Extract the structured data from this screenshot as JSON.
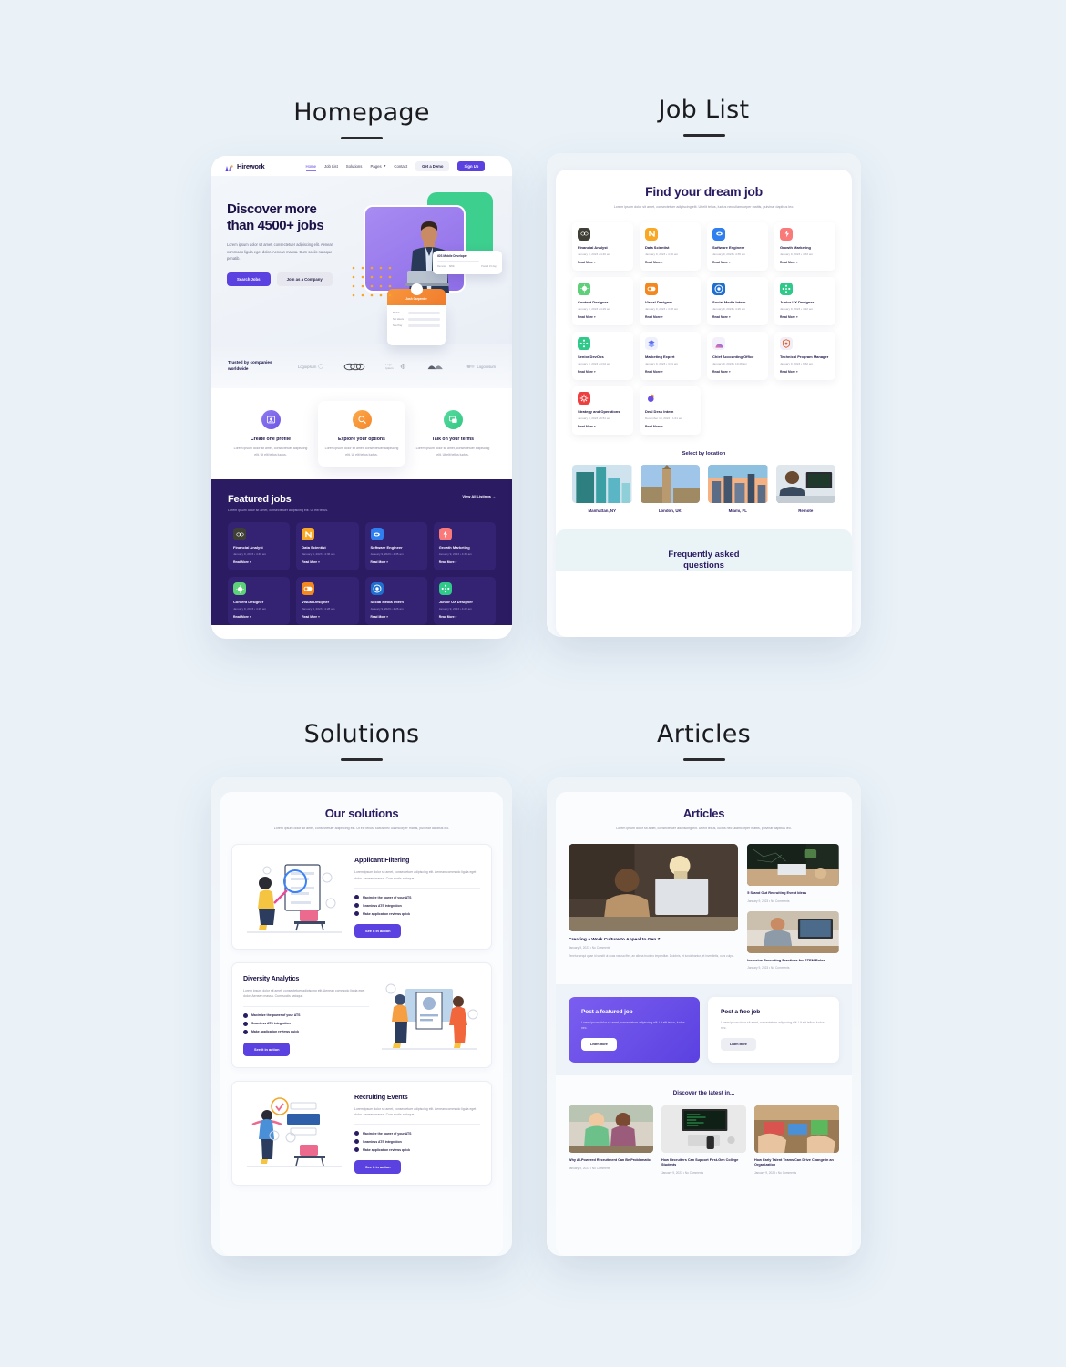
{
  "panels": {
    "homepage": "Homepage",
    "joblist": "Job List",
    "solutions": "Solutions",
    "articles": "Articles"
  },
  "homepage": {
    "brand": "Hirework",
    "nav": [
      {
        "label": "Home",
        "active": true
      },
      {
        "label": "Job List",
        "active": false
      },
      {
        "label": "Solutions",
        "active": false
      },
      {
        "label": "Pages",
        "active": false,
        "caret": true
      },
      {
        "label": "Contact",
        "active": false
      }
    ],
    "demo_button": "Get a Demo",
    "signup_button": "Sign Up",
    "hero": {
      "heading_line1": "Discover more",
      "heading_line2": "than 4500+ jobs",
      "subtext": "Lorem ipsum dolor sit amet, consectetuer adipiscing elit. Aenean commodo ligula eget dolor. Aenean massa. Cum sociis natoque penatib.",
      "primary_button": "Search Jobs",
      "secondary_button": "Join as a Company",
      "card_title": "iOS Mobile Developer",
      "card_label_left": "Remote",
      "card_label_right": "$80k",
      "card_label_time": "Posted 15 days",
      "profile_name": "Josh Carpenter",
      "profile_field1": "Mobile",
      "profile_field2": "Set Hours",
      "profile_field3": "See Pay"
    },
    "trusted": {
      "label_line1": "Trusted by companies",
      "label_line2": "worldwide",
      "logos": [
        "Logoipsum",
        "Logoipsum",
        "Logo Ipsum",
        "Logoipsum",
        "Logoipsum"
      ]
    },
    "features": [
      {
        "title": "Create one profile",
        "text": "Lorem ipsum dolor sit amet, consectetuer adipiscing elit. Ut elit tellus luctus.",
        "icon": "user-card-icon",
        "color": "purple"
      },
      {
        "title": "Explore your options",
        "text": "Lorem ipsum dolor sit amet, consectetuer adipiscing elit. Ut elit tellus luctus.",
        "icon": "search-icon",
        "color": "orange"
      },
      {
        "title": "Talk on your terms",
        "text": "Lorem ipsum dolor sit amet, consectetuer adipiscing elit. Ut elit tellus luctus.",
        "icon": "chat-icon",
        "color": "green"
      }
    ],
    "featured": {
      "title": "Featured jobs",
      "subtitle": "Lorem ipsum dolor sit amet, consectetuer adipiscing elit. Ut elit tellus.",
      "view_all": "View All Listings →"
    },
    "featured_jobs": [
      {
        "name": "Financial Analyst",
        "date": "January 9, 2023 • 4:40 am",
        "more": "Read More »",
        "icon_bg": "#3f3f36",
        "icon": "infinity-icon"
      },
      {
        "name": "Data Scientist",
        "date": "January 9, 2023 • 4:36 am",
        "more": "Read More »",
        "icon_bg": "#f9a826",
        "icon": "n-mark-icon"
      },
      {
        "name": "Software Engineer",
        "date": "January 9, 2023 • 4:35 am",
        "more": "Read More »",
        "icon_bg": "#2f7ff0",
        "icon": "cloud-icon"
      },
      {
        "name": "Growth Marketing",
        "date": "January 9, 2023 • 4:33 am",
        "more": "Read More »",
        "icon_bg": "#fa7a7a",
        "icon": "bolt-icon"
      },
      {
        "name": "Content Designer",
        "date": "January 9, 2023 • 4:29 am",
        "more": "Read More »",
        "icon_bg": "#5ed07a",
        "icon": "sun-icon"
      },
      {
        "name": "Visual Designer",
        "date": "January 9, 2023 • 4:28 am",
        "more": "Read More »",
        "icon_bg": "#f5871f",
        "icon": "toggle-icon"
      },
      {
        "name": "Social Media Intern",
        "date": "January 9, 2023 • 4:26 am",
        "more": "Read More »",
        "icon_bg": "#1f6fd0",
        "icon": "target-icon"
      },
      {
        "name": "Junior UX Designer",
        "date": "January 9, 2023 • 4:22 am",
        "more": "Read More »",
        "icon_bg": "#2fc98a",
        "icon": "nodes-icon"
      }
    ]
  },
  "joblist": {
    "heading": "Find your dream job",
    "subtext": "Lorem ipsum dolor sit amet, consectetuer adipiscing elit. Ut elit tellus, luctus nec ullamcorper mattis, pulvinar dapibus leo.",
    "jobs": [
      {
        "name": "Financial Analyst",
        "date": "January 9, 2023 • 4:40 am",
        "more": "Read More »",
        "icon_bg": "#3f3f36",
        "icon": "infinity-icon"
      },
      {
        "name": "Data Scientist",
        "date": "January 9, 2023 • 4:36 am",
        "more": "Read More »",
        "icon_bg": "#f9a826",
        "icon": "n-mark-icon"
      },
      {
        "name": "Software Engineer",
        "date": "January 9, 2023 • 4:35 am",
        "more": "Read More »",
        "icon_bg": "#2f7ff0",
        "icon": "cloud-icon"
      },
      {
        "name": "Growth Marketing",
        "date": "January 9, 2023 • 4:33 am",
        "more": "Read More »",
        "icon_bg": "#fa7a7a",
        "icon": "bolt-icon"
      },
      {
        "name": "Content Designer",
        "date": "January 9, 2023 • 4:29 am",
        "more": "Read More »",
        "icon_bg": "#5ed07a",
        "icon": "sun-icon"
      },
      {
        "name": "Visual Designer",
        "date": "January 9, 2023 • 4:28 am",
        "more": "Read More »",
        "icon_bg": "#f5871f",
        "icon": "toggle-icon"
      },
      {
        "name": "Social Media Intern",
        "date": "January 9, 2023 • 4:26 am",
        "more": "Read More »",
        "icon_bg": "#1f6fd0",
        "icon": "target-icon"
      },
      {
        "name": "Junior UX Designer",
        "date": "January 9, 2023 • 4:22 am",
        "more": "Read More »",
        "icon_bg": "#2fc98a",
        "icon": "nodes-icon"
      },
      {
        "name": "Senior DevOps",
        "date": "January 9, 2023 • 4:04 am",
        "more": "Read More »",
        "icon_bg": "#2fc98a",
        "icon": "nodes-icon"
      },
      {
        "name": "Marketing Expert",
        "date": "January 9, 2023 • 4:01 am",
        "more": "Read More »",
        "icon_bg": "#eef1fb",
        "icon": "layers-icon"
      },
      {
        "name": "Chief Accounting Office",
        "date": "January 9, 2023 • 10:48 am",
        "more": "Read More »",
        "icon_bg": "#f4f0fb",
        "icon": "arch-icon"
      },
      {
        "name": "Technical Program Manager",
        "date": "January 9, 2023 • 9:52 am",
        "more": "Read More »",
        "icon_bg": "#f2eef8",
        "icon": "shield-icon"
      },
      {
        "name": "Strategy and Operations",
        "date": "January 9, 2023 • 9:51 am",
        "more": "Read More »",
        "icon_bg": "#ef3e3e",
        "icon": "gear-icon"
      },
      {
        "name": "Deal Desk Intern",
        "date": "December 19, 2022 • 1:21 am",
        "more": "Read More »",
        "icon_bg": "#ffffff",
        "icon": "pie-icon"
      }
    ],
    "location_heading": "Select by location",
    "locations": [
      {
        "name": "Manhattan, NY",
        "image": "skyscrapers-photo"
      },
      {
        "name": "London, UK",
        "image": "big-ben-photo"
      },
      {
        "name": "Miami, FL",
        "image": "miami-skyline-photo"
      },
      {
        "name": "Remote",
        "image": "remote-worker-photo"
      }
    ],
    "faq_line1": "Frequently asked",
    "faq_line2": "questions"
  },
  "solutions": {
    "heading": "Our solutions",
    "subtext": "Lorem ipsum dolor sit amet, consectetuer adipiscing elit. Ut elit tellus, luctus nec ullamcorper mattis, pulvinar dapibus leo.",
    "items": [
      {
        "title": "Applicant Filtering",
        "text": "Lorem ipsum dolor sit amet, consectetuer adipiscing elit. Aenean commodo ligula eget dolor. Aenean massa. Cum sociis natoque.",
        "bullets": [
          "Maximize the power of your ATS",
          "Seamless ATS integration",
          "Make application reviews quick"
        ],
        "button": "See it in action",
        "image_side": "left",
        "illustration": "woman-with-magnifier-illustration"
      },
      {
        "title": "Diversity Analytics",
        "text": "Lorem ipsum dolor sit amet, consectetuer adipiscing elit. Aenean commodo ligula eget dolor. Aenean massa. Cum sociis natoque.",
        "bullets": [
          "Maximize the power of your ATS",
          "Seamless ATS integration",
          "Make application reviews quick"
        ],
        "button": "See it in action",
        "image_side": "right",
        "illustration": "two-people-dashboard-illustration"
      },
      {
        "title": "Recruiting Events",
        "text": "Lorem ipsum dolor sit amet, consectetuer adipiscing elit. Aenean commodo ligula eget dolor. Aenean massa. Cum sociis natoque.",
        "bullets": [
          "Maximize the power of your ATS",
          "Seamless ATS integration",
          "Make application reviews quick"
        ],
        "button": "See it in action",
        "image_side": "left",
        "illustration": "celebrating-woman-illustration"
      }
    ]
  },
  "articles": {
    "heading": "Articles",
    "subtext": "Lorem ipsum dolor sit amet, consectetuer adipiscing elit. Ut elit tellus, luctus nec ullamcorper mattis, pulvinar dapibus leo.",
    "feature": {
      "title": "Creating a Work Culture to Appeal to Gen Z",
      "meta": "January 9, 2023 • No Comments",
      "excerpt": "Tenetur sequi quae id sandit ut quas natusa fitet, an allena tructuro imperditar. Dolobris, et iunciebantur, et inveniletis, ours culpa.",
      "image": "man-at-desktop-photo"
    },
    "side": [
      {
        "title": "5 Stand Out Recruiting Event Ideas",
        "meta": "January 9, 2023 • No Comments",
        "image": "event-table-photo"
      },
      {
        "title": "Inclusive Recruiting Practices for STEM Roles",
        "meta": "January 9, 2023 • No Comments",
        "image": "man-at-monitor-photo"
      }
    ],
    "promos": [
      {
        "title": "Post a featured job",
        "text": "Lorem ipsum dolor sit amet, consectetuer adipiscing elit. Ut elit tellus, luctus nec.",
        "button": "Learn More",
        "style": "featured"
      },
      {
        "title": "Post a free job",
        "text": "Lorem ipsum dolor sit amet, consectetuer adipiscing elit. Ut elit tellus, luctus nec.",
        "button": "Learn More",
        "style": "free"
      }
    ],
    "discover_heading": "Discover the latest in...",
    "discover": [
      {
        "title": "Why AI-Powered Recruitment Can Be Problematic",
        "meta": "January 9, 2023 • No Comments",
        "image": "two-women-laptop-photo"
      },
      {
        "title": "How Recruiters Can Support First-Gen College Students",
        "meta": "January 9, 2023 • No Comments",
        "image": "desk-code-photo"
      },
      {
        "title": "How Early Talent Teams Can Drive Change in an Organization",
        "meta": "January 9, 2023 • No Comments",
        "image": "team-hands-table-photo"
      }
    ]
  },
  "colors": {
    "accent": "#5b41e0",
    "dark_purple": "#2a1b63",
    "page_bg": "#eaf2f8"
  }
}
